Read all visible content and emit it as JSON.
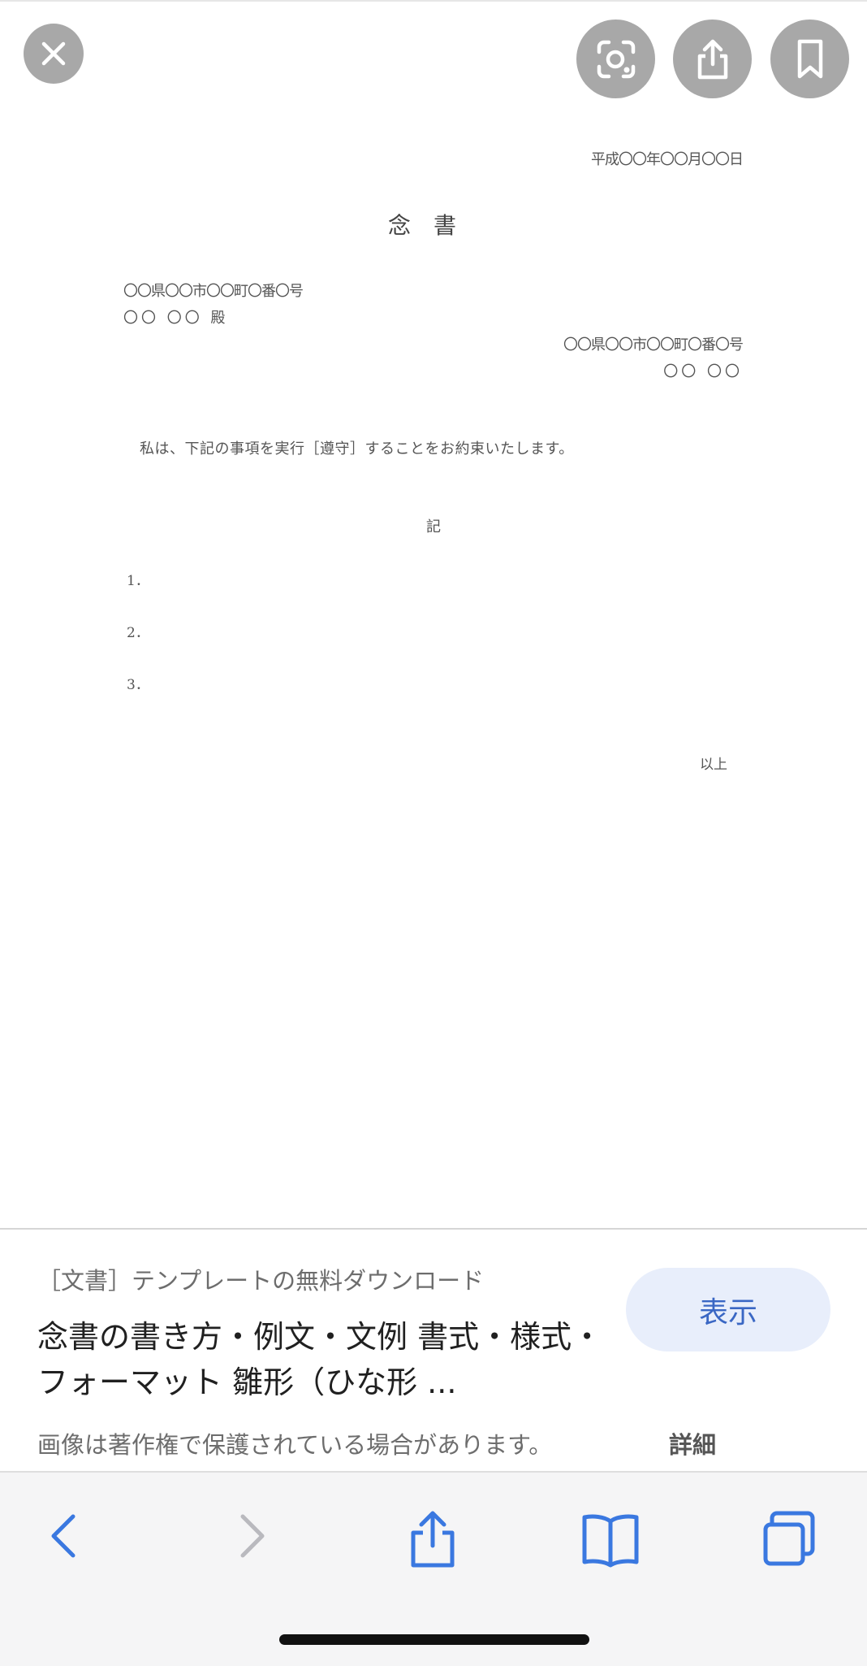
{
  "document": {
    "date": "平成〇〇年〇〇月〇〇日",
    "title": "念書",
    "recipient_address": "〇〇県〇〇市〇〇町〇番〇号",
    "recipient_name": "〇〇 〇〇 殿",
    "sender_address": "〇〇県〇〇市〇〇町〇番〇号",
    "sender_name": "〇〇 〇〇",
    "body": "私は、下記の事項を実行［遵守］することをお約束いたします。",
    "ki": "記",
    "items": [
      "1．",
      "2．",
      "3．"
    ],
    "ijou": "以上"
  },
  "caption": {
    "source": "［文書］テンプレートの無料ダウンロード",
    "title": "念書の書き方・例文・文例 書式・様式・フォーマット 雛形（ひな形 ...",
    "view_button": "表示",
    "copyright_notice": "画像は著作権で保護されている場合があります。",
    "details_link": "詳細"
  },
  "icons": {
    "close": "close-icon",
    "lens": "lens-icon",
    "share": "share-icon",
    "bookmark": "bookmark-icon",
    "back": "back-chevron-icon",
    "forward": "forward-chevron-icon",
    "toolbar_share": "share-icon",
    "bookmarks": "book-icon",
    "tabs": "tabs-icon"
  },
  "colors": {
    "accent": "#3a67c4",
    "button_bg": "#e8eefb",
    "overlay_button": "#a8a8a8"
  }
}
